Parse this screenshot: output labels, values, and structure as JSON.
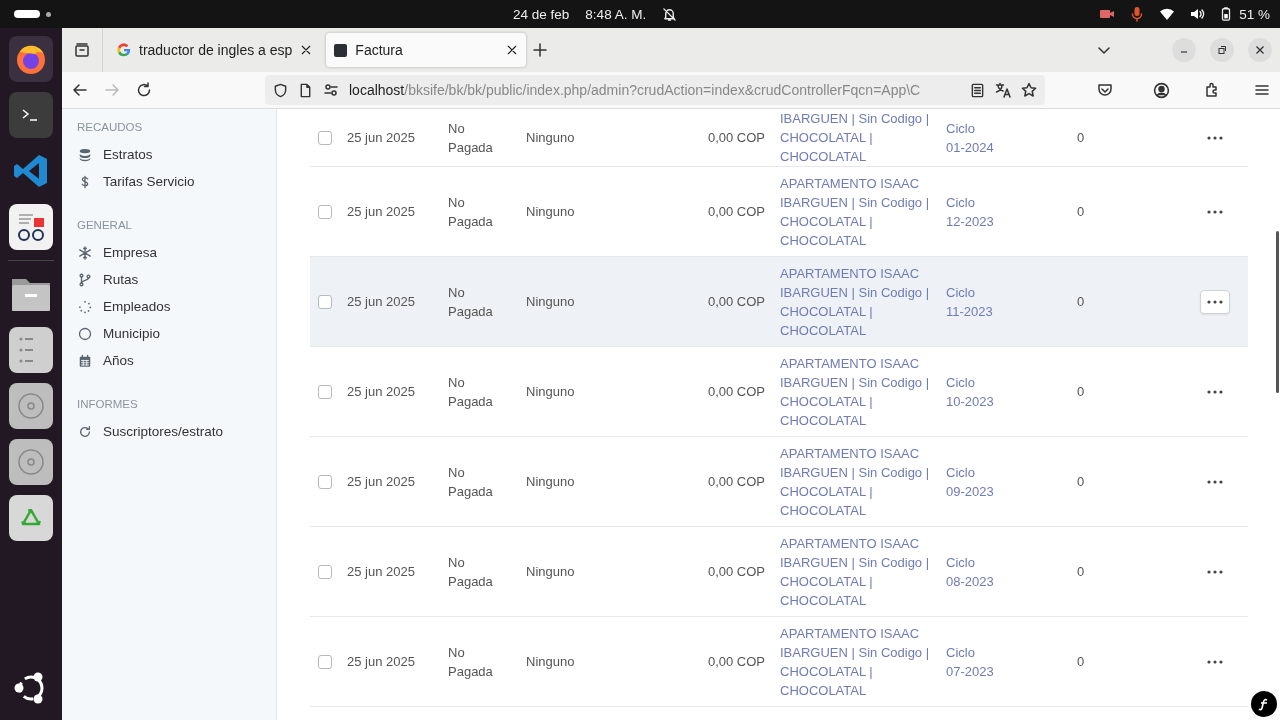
{
  "top_bar": {
    "date": "24 de feb",
    "time": "8:48 A. M.",
    "battery": "51 %"
  },
  "browser": {
    "tabs": [
      {
        "title": "traductor de ingles a esp",
        "kind": "google",
        "selected": false
      },
      {
        "title": "Factura",
        "kind": "page",
        "selected": true
      }
    ],
    "url_host": "localhost",
    "url_path": "/bksife/bk/bk/public/index.php/admin?crudAction=index&crudControllerFqcn=App\\C"
  },
  "sidebar": {
    "sections": [
      {
        "heading": "RECAUDOS",
        "items": [
          {
            "label": "Estratos"
          },
          {
            "label": "Tarifas Servicio"
          }
        ]
      },
      {
        "heading": "GENERAL",
        "items": [
          {
            "label": "Empresa"
          },
          {
            "label": "Rutas"
          },
          {
            "label": "Empleados"
          },
          {
            "label": "Municipio"
          },
          {
            "label": "Años"
          }
        ]
      },
      {
        "heading": "INFORMES",
        "items": [
          {
            "label": "Suscriptores/estrato"
          }
        ]
      }
    ]
  },
  "table": {
    "rows": [
      {
        "checked": false,
        "hovered": false,
        "date": "25 jun 2025",
        "status": "No Pagada",
        "column_3": "Ninguno",
        "amount": "0,00 COP",
        "property": "IBARGUEN | Sin Codigo | CHOCOLATAL | CHOCOLATAL",
        "period": "Ciclo 01-2024",
        "column_7": "0"
      },
      {
        "checked": false,
        "hovered": false,
        "date": "25 jun 2025",
        "status": "No Pagada",
        "column_3": "Ninguno",
        "amount": "0,00 COP",
        "property": "APARTAMENTO ISAAC IBARGUEN | Sin Codigo | CHOCOLATAL | CHOCOLATAL",
        "period": "Ciclo 12-2023",
        "column_7": "0"
      },
      {
        "checked": false,
        "hovered": true,
        "date": "25 jun 2025",
        "status": "No Pagada",
        "column_3": "Ninguno",
        "amount": "0,00 COP",
        "property": "APARTAMENTO ISAAC IBARGUEN | Sin Codigo | CHOCOLATAL | CHOCOLATAL",
        "period": "Ciclo 11-2023",
        "column_7": "0"
      },
      {
        "checked": false,
        "hovered": false,
        "date": "25 jun 2025",
        "status": "No Pagada",
        "column_3": "Ninguno",
        "amount": "0,00 COP",
        "property": "APARTAMENTO ISAAC IBARGUEN | Sin Codigo | CHOCOLATAL | CHOCOLATAL",
        "period": "Ciclo 10-2023",
        "column_7": "0"
      },
      {
        "checked": false,
        "hovered": false,
        "date": "25 jun 2025",
        "status": "No Pagada",
        "column_3": "Ninguno",
        "amount": "0,00 COP",
        "property": "APARTAMENTO ISAAC IBARGUEN | Sin Codigo | CHOCOLATAL | CHOCOLATAL",
        "period": "Ciclo 09-2023",
        "column_7": "0"
      },
      {
        "checked": false,
        "hovered": false,
        "date": "25 jun 2025",
        "status": "No Pagada",
        "column_3": "Ninguno",
        "amount": "0,00 COP",
        "property": "APARTAMENTO ISAAC IBARGUEN | Sin Codigo | CHOCOLATAL | CHOCOLATAL",
        "period": "Ciclo 08-2023",
        "column_7": "0"
      },
      {
        "checked": false,
        "hovered": false,
        "date": "25 jun 2025",
        "status": "No Pagada",
        "column_3": "Ninguno",
        "amount": "0,00 COP",
        "property": "APARTAMENTO ISAAC IBARGUEN | Sin Codigo | CHOCOLATAL | CHOCOLATAL",
        "period": "Ciclo 07-2023",
        "column_7": "0"
      }
    ]
  }
}
